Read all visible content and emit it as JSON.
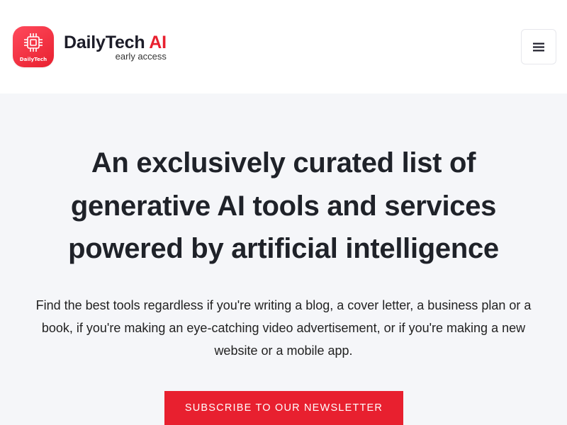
{
  "header": {
    "logo": {
      "icon": "chip-icon",
      "badge_text": "DailyTech",
      "brand_color": "#e8202f"
    },
    "brand_name": "DailyTech",
    "brand_accent": "AI",
    "tagline": "early access",
    "menu_icon": "hamburger-menu-icon"
  },
  "hero": {
    "title": "An exclusively curated list of generative AI tools and services powered by artificial intelligence",
    "description": "Find the best tools regardless if you're writing a blog, a cover letter, a business plan or a book, if you're making an eye-catching video advertisement, or if you're making a new website or a mobile app.",
    "cta_label": "Subscribe to our newsletter",
    "background_color": "#f5f6f9",
    "cta_color": "#e8202f"
  }
}
